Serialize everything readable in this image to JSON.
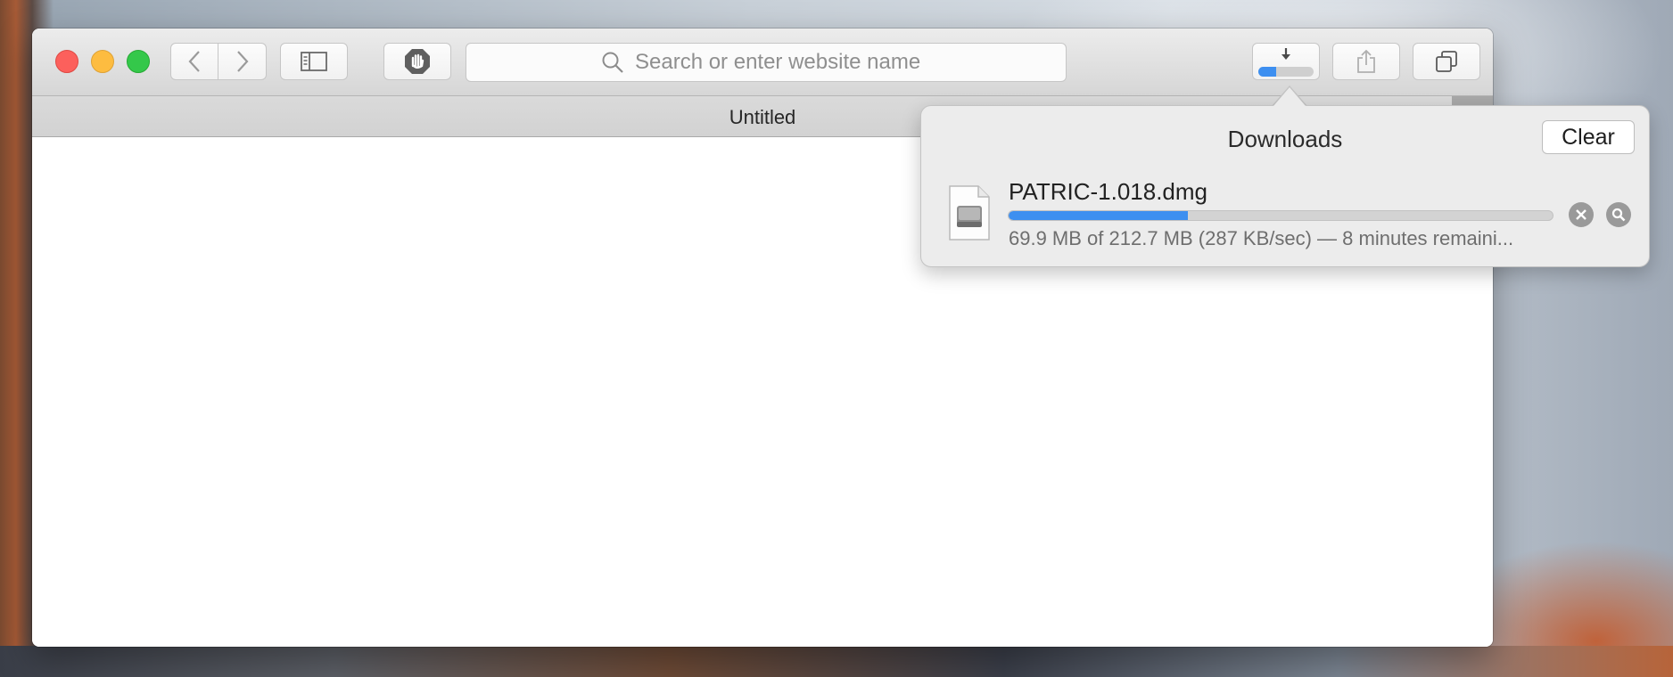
{
  "toolbar": {
    "search_placeholder": "Search or enter website name",
    "download_progress_fraction": 0.33
  },
  "tab": {
    "title": "Untitled"
  },
  "downloads": {
    "title": "Downloads",
    "clear_label": "Clear",
    "item": {
      "file_name": "PATRIC-1.018.dmg",
      "status": "69.9 MB of 212.7 MB (287 KB/sec) — 8 minutes remaini...",
      "progress_fraction": 0.33
    }
  },
  "colors": {
    "progress_blue": "#3d8ff0",
    "close": "#fc605c",
    "minimize": "#fdbc40",
    "maximize": "#34c84a"
  }
}
